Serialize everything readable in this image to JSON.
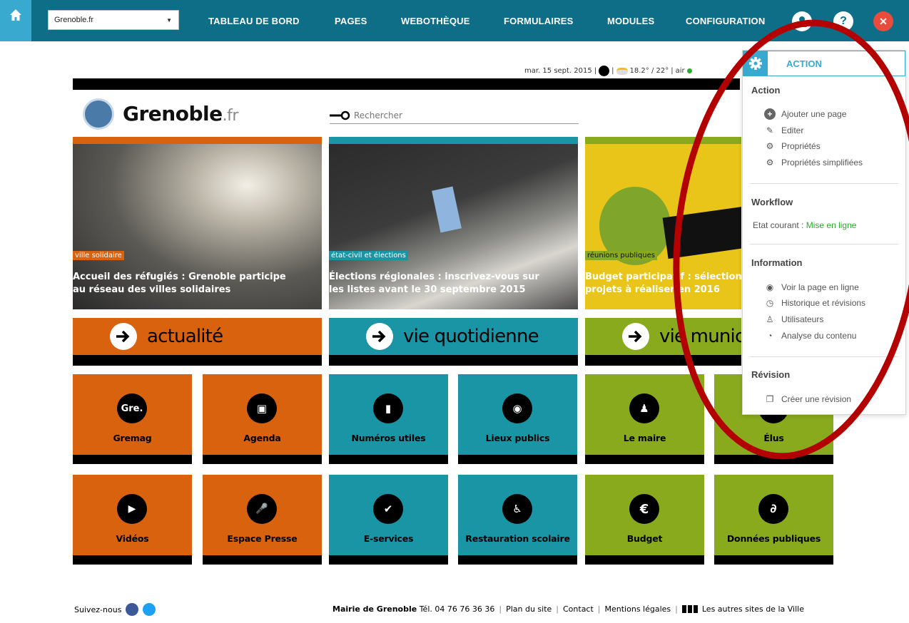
{
  "topbar": {
    "site_select": "Grenoble.fr",
    "nav": [
      "TABLEAU DE BORD",
      "PAGES",
      "WEBOTHÈQUE",
      "FORMULAIRES",
      "MODULES",
      "CONFIGURATION"
    ],
    "help_icon_glyph": "?",
    "close_icon_glyph": "✕"
  },
  "meta": {
    "date": "mar. 15 sept. 2015",
    "weather": "18.2° / 22°",
    "air": "air"
  },
  "logo": {
    "name": "Grenoble",
    "suffix": ".fr"
  },
  "search": {
    "placeholder": "Rechercher"
  },
  "features": [
    {
      "tag": "ville solidaire",
      "title1": "Accueil des réfugiés : Grenoble participe",
      "title2": "au réseau des villes solidaires"
    },
    {
      "tag": "état-civil et élections",
      "title1": "Élections régionales : inscrivez-vous sur",
      "title2": "les listes avant le 30 septembre 2015"
    },
    {
      "tag": "réunions publiques",
      "title1": "Budget participatif : sélection des",
      "title2": "projets à réaliser en 2016"
    }
  ],
  "sections": [
    "actualité",
    "vie quotidienne",
    "vie municipale"
  ],
  "tiles": [
    {
      "label": "Gremag",
      "glyph": "Gre."
    },
    {
      "label": "Agenda",
      "glyph": "▣"
    },
    {
      "label": "Numéros utiles",
      "glyph": "▮"
    },
    {
      "label": "Lieux publics",
      "glyph": "◉"
    },
    {
      "label": "Le maire",
      "glyph": "♟"
    },
    {
      "label": "Élus",
      "glyph": "♟"
    },
    {
      "label": "Vidéos",
      "glyph": "▶"
    },
    {
      "label": "Espace Presse",
      "glyph": "🎤"
    },
    {
      "label": "E-services",
      "glyph": "✔"
    },
    {
      "label": "Restauration scolaire",
      "glyph": "♿"
    },
    {
      "label": "Budget",
      "glyph": "€"
    },
    {
      "label": "Données publiques",
      "glyph": "∂"
    }
  ],
  "footer": {
    "follow": "Suivez-nous",
    "mairie": "Mairie de Grenoble",
    "tel": "Tél. 04 76 76 36 36",
    "links": [
      "Plan du site",
      "Contact",
      "Mentions légales"
    ],
    "other_sites": "Les autres sites de la Ville"
  },
  "panel": {
    "title": "ACTION",
    "action": {
      "heading": "Action",
      "items": [
        "Ajouter une page",
        "Editer",
        "Propriétés",
        "Propriétés simplifiées"
      ]
    },
    "workflow": {
      "heading": "Workflow",
      "state_label": "Etat courant :",
      "state_value": "Mise en ligne"
    },
    "information": {
      "heading": "Information",
      "items": [
        "Voir la page en ligne",
        "Historique et révisions",
        "Utilisateurs",
        "Analyse du contenu"
      ]
    },
    "revision": {
      "heading": "Révision",
      "items": [
        "Créer une révision"
      ]
    }
  },
  "colors": {
    "topbar": "#0f6e87",
    "accent": "#3aa9d0",
    "orange": "#d9620f",
    "teal": "#1a95a6",
    "green": "#8aaa1e",
    "annotation": "#b30000"
  }
}
